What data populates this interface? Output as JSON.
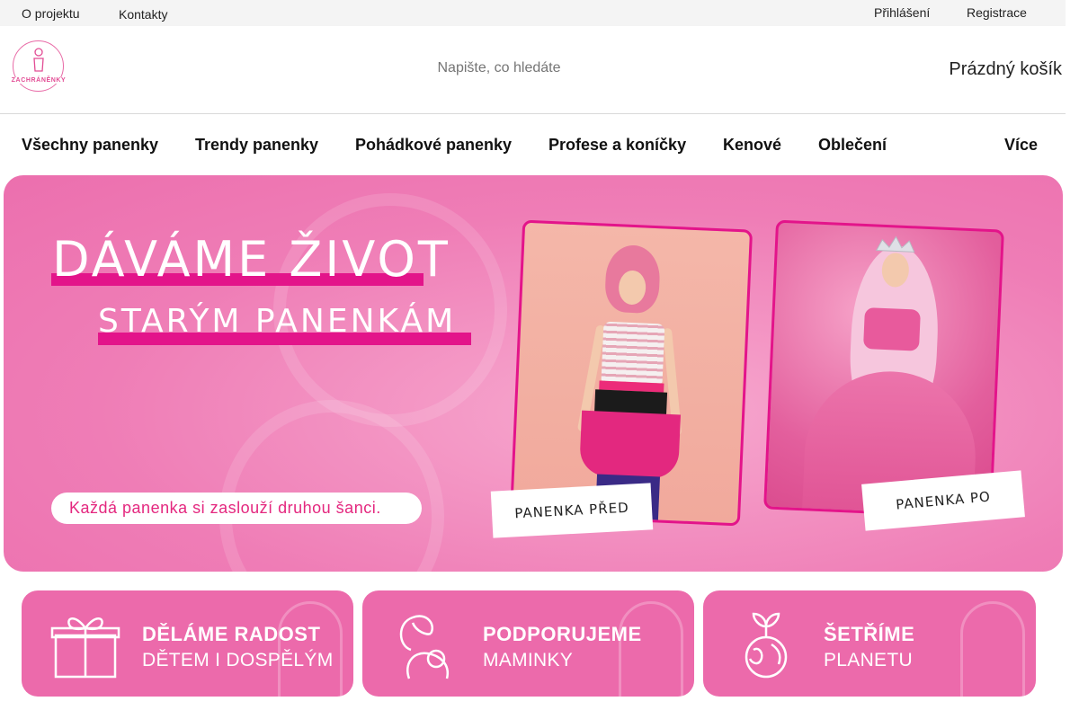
{
  "topbar": {
    "links": [
      "O projektu",
      "Kontakty"
    ],
    "login": "Přihlášení",
    "register": "Registrace"
  },
  "header": {
    "logo_text": "ZACHRÁNĚNKY",
    "search_placeholder": "Napište, co hledáte",
    "cart": "Prázdný košík"
  },
  "nav": {
    "items": [
      "Všechny panenky",
      "Trendy panenky",
      "Pohádkové panenky",
      "Profese a koníčky",
      "Kenové",
      "Oblečení"
    ],
    "more": "Více"
  },
  "hero": {
    "title_line1": "DÁVÁME ŽIVOT",
    "title_line2": "STARÝM PANENKÁM",
    "tagline": "Každá panenka si zaslouží druhou šanci.",
    "before_label": "PANENKA PŘED",
    "after_label": "PANENKA PO"
  },
  "features": [
    {
      "headline": "DĚLÁME RADOST",
      "sub": "DĚTEM I DOSPĚLÝM",
      "icon": "gift-icon"
    },
    {
      "headline": "PODPORUJEME",
      "sub": "MAMINKY",
      "icon": "mother-child-icon"
    },
    {
      "headline": "ŠETŘÍME",
      "sub": "PLANETU",
      "icon": "globe-sprout-icon"
    }
  ],
  "colors": {
    "brand_pink": "#ec6aab",
    "accent_magenta": "#e3148a",
    "topbar_bg": "#f4f4f4"
  }
}
